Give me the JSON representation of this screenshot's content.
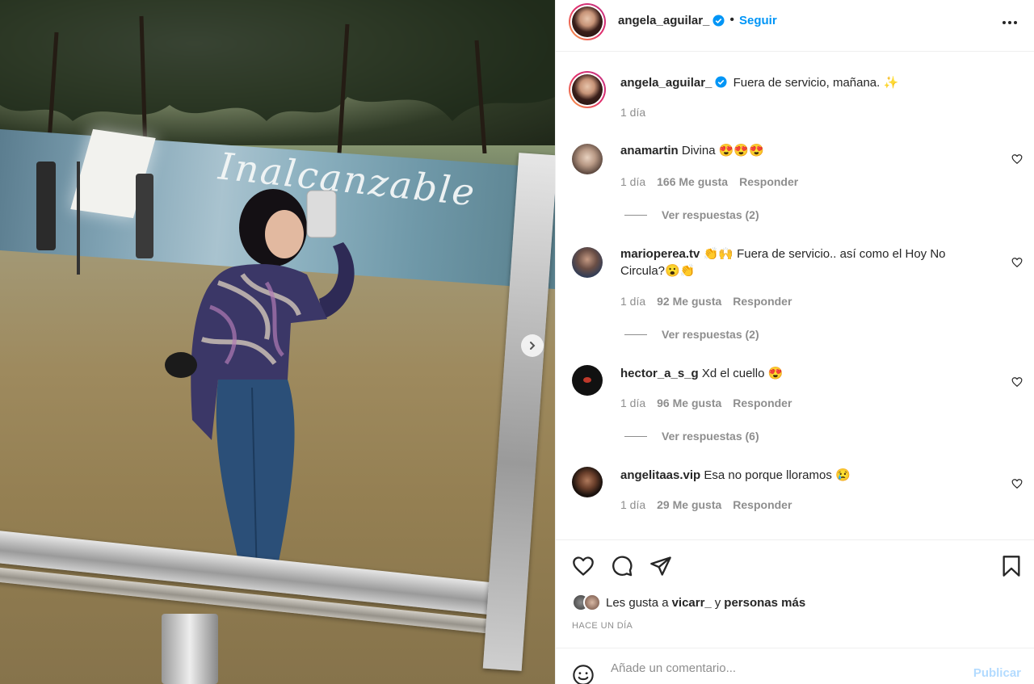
{
  "post": {
    "username": "angela_aguilar_",
    "follow_label": "Seguir",
    "dot": "•",
    "caption": "Fuera de servicio, mañana. ✨",
    "caption_time": "1 día",
    "mural_text": "Inalcanzable"
  },
  "comments": [
    {
      "user": "anamartin",
      "text": "Divina 😍😍😍",
      "time": "1 día",
      "likes": "166 Me gusta",
      "reply": "Responder",
      "replies": "Ver respuestas (2)"
    },
    {
      "user": "marioperea.tv",
      "text": "👏🙌 Fuera de servicio.. así como el Hoy No Circula?😮👏",
      "time": "1 día",
      "likes": "92 Me gusta",
      "reply": "Responder",
      "replies": "Ver respuestas (2)"
    },
    {
      "user": "hector_a_s_g",
      "text": "Xd el cuello 😍",
      "time": "1 día",
      "likes": "96 Me gusta",
      "reply": "Responder",
      "replies": "Ver respuestas (6)"
    },
    {
      "user": "angelitaas.vip",
      "text": "Esa no porque lloramos 😢",
      "time": "1 día",
      "likes": "29 Me gusta",
      "reply": "Responder"
    }
  ],
  "likes": {
    "prefix": "Les gusta a",
    "user": "vicarr_",
    "connector": "y",
    "others": "personas más"
  },
  "time_ago": "HACE UN DÍA",
  "add_comment": {
    "placeholder": "Añade un comentario...",
    "publish_label": "Publicar"
  },
  "colors": {
    "accent": "#0095f6",
    "publish_disabled": "#b3dbff",
    "muted": "#8e8e8e",
    "text": "#262626"
  },
  "icons": [
    "verified-badge-icon",
    "more-options-icon",
    "heart-icon",
    "comment-icon",
    "share-icon",
    "save-icon",
    "emoji-icon",
    "chevron-right-icon"
  ]
}
